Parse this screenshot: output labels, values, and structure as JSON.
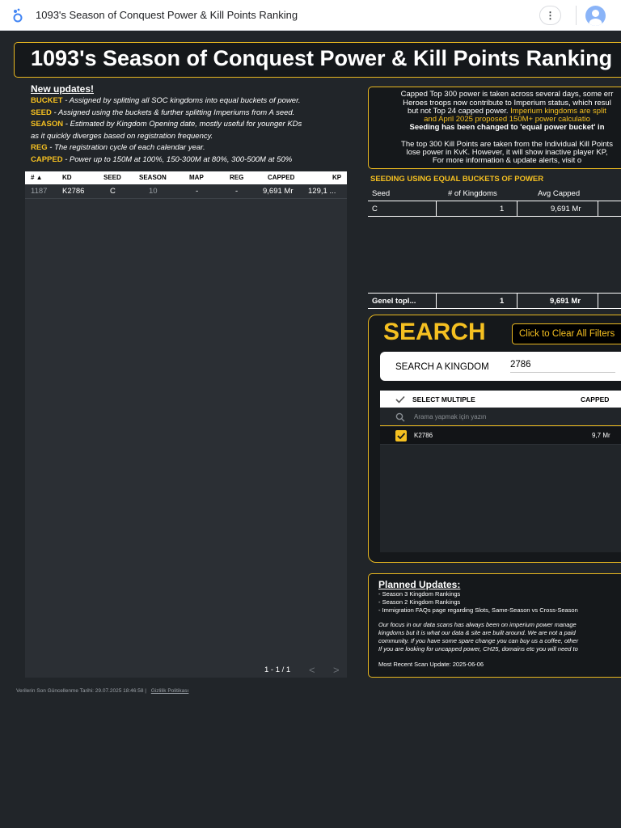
{
  "app": {
    "title": "1093's Season of Conquest Power & Kill Points Ranking",
    "more_symbol": "⋮"
  },
  "report": {
    "heading": "1093's Season of Conquest Power & Kill Points Ranking",
    "notes": {
      "title": "New updates!",
      "lines": [
        {
          "key": "BUCKET",
          "text": " - Assigned by splitting all SOC kingdoms into equal buckets of power."
        },
        {
          "key": "SEED",
          "text": " - Assigned using the buckets & further splitting Imperiums from A seed."
        },
        {
          "key": "SEASON",
          "text": " - Estimated by Kingdom Opening date, mostly useful for younger KDs"
        },
        {
          "key": "",
          "text": "as it quickly diverges based on registration frequency."
        },
        {
          "key": "REG",
          "text": " - The registration cycle of each calendar year."
        },
        {
          "key": "CAPPED",
          "text": " - Power up to 150M at 100%, 150-300M at 80%, 300-500M at 50%"
        }
      ]
    },
    "table": {
      "columns": [
        "# ▲",
        "KD",
        "SEED",
        "SEASON",
        "MAP",
        "REG",
        "CAPPED",
        "KP"
      ],
      "rows": [
        {
          "rank": "1187",
          "kd": "K2786",
          "seed": "C",
          "season": "10",
          "map": "-",
          "reg": "-",
          "capped": "9,691 Mr",
          "kp": "129,1 ..."
        }
      ],
      "pagination": "1 - 1 / 1",
      "prev": "<",
      "next": ">"
    },
    "footer": {
      "updated": "Verilerin Son Güncellenme Tarihi: 29.07.2025 18:46:58",
      "separator": "|",
      "privacy": "Gizlilik Politikası"
    },
    "info": {
      "l1": "Capped Top 300 power is taken across several days, some err",
      "l2": "Heroes troops now contribute to Imperium status, which resul",
      "l3a": "but not Top 24 capped power. ",
      "l3b": "Imperium kingdoms are split",
      "l4": "and April 2025 proposed 150M+ power calculatio",
      "l5": "Seeding has been changed to 'equal power bucket' in",
      "l6": "The top 300 Kill Points are taken from the Individual Kill Points",
      "l7": "lose power in KvK. However, it will show inactive player KP,",
      "l8": "For more information & update alerts, visit o"
    },
    "seeding": {
      "title": "SEEDING USING EQUAL BUCKETS OF POWER",
      "headers": [
        "Seed",
        "# of Kingdoms",
        "Avg Capped"
      ],
      "row": {
        "seed": "C",
        "count": "1",
        "avg": "9,691 Mr"
      },
      "total": {
        "label": "Genel topl...",
        "count": "1",
        "avg": "9,691 Mr"
      }
    },
    "search": {
      "title": "SEARCH",
      "clear_label": "Click to Clear All Filters",
      "kingdom_label": "SEARCH A KINGDOM",
      "kingdom_value": "2786",
      "select_multiple": "SELECT MULTIPLE",
      "capped_header": "CAPPED",
      "search_placeholder": "Arama yapmak için yazın",
      "items": [
        {
          "name": "K2786",
          "value": "9,7 Mr",
          "checked": true
        }
      ]
    },
    "planned": {
      "title": "Planned Updates:",
      "items": [
        "- Season 3 Kingdom Rankings",
        "- Season 2 Kingdom Rankings",
        "- Immigration FAQs page regarding Slots, Same-Season vs Cross-Season"
      ],
      "p1": "Our focus in our data scans has always been on imperium power manage",
      "p2": "kingdoms but it is what our data & site are built around. We are not a paid",
      "p3": "community. If you have some spare change you can buy us a coffee, other",
      "p4": "If you are looking for uncapped power, CH25, domains etc you will need to",
      "scan": "Most Recent Scan Update: 2025-06-06"
    }
  },
  "colors": {
    "background": "#212529",
    "accent": "#f5c021",
    "panel": "#15181b"
  }
}
